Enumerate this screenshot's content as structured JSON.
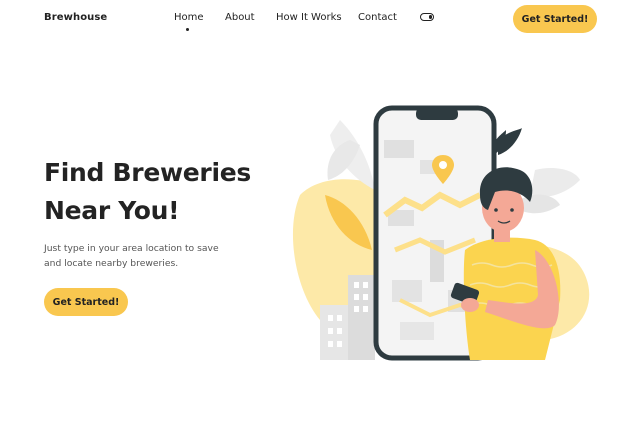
{
  "nav": {
    "brand": "Brewhouse",
    "links": [
      "Home",
      "About",
      "How It Works",
      "Contact"
    ],
    "active": "Home",
    "cta_label": "Get Started!"
  },
  "hero": {
    "title_line1": "Find Breweries",
    "title_line2": "Near You!",
    "subtitle_line1": "Just type in your area location to save",
    "subtitle_line2": "and locate nearby breweries.",
    "cta_label": "Get Started!"
  },
  "colors": {
    "accent": "#f9c74f",
    "text": "#222222",
    "illustration_yellow": "#fbd44f",
    "illustration_light": "#fde9a8"
  },
  "icons": {
    "theme_toggle": "toggle-icon",
    "map_pin": "location-pin-icon"
  }
}
